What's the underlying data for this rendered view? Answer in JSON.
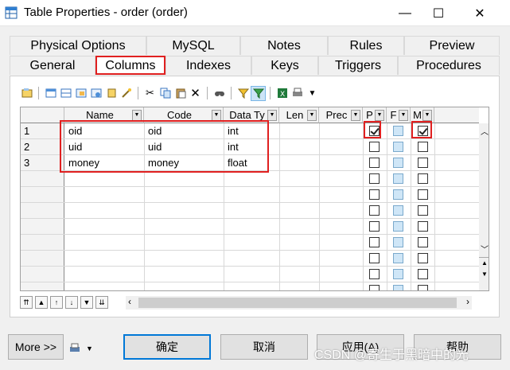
{
  "window": {
    "title": "Table Properties - order (order)"
  },
  "tabs_row1": [
    {
      "label": "Physical Options"
    },
    {
      "label": "MySQL"
    },
    {
      "label": "Notes"
    },
    {
      "label": "Rules"
    },
    {
      "label": "Preview"
    }
  ],
  "tabs_row2": [
    {
      "label": "General"
    },
    {
      "label": "Columns"
    },
    {
      "label": "Indexes"
    },
    {
      "label": "Keys"
    },
    {
      "label": "Triggers"
    },
    {
      "label": "Procedures"
    }
  ],
  "grid": {
    "headers": [
      "Name",
      "Code",
      "Data Ty",
      "Len",
      "Prec",
      "P",
      "F",
      "M"
    ],
    "rows": [
      {
        "num": "1",
        "name": "oid",
        "code": "oid",
        "type": "int",
        "p": true,
        "m": true
      },
      {
        "num": "2",
        "name": "uid",
        "code": "uid",
        "type": "int",
        "p": false,
        "m": false
      },
      {
        "num": "3",
        "name": "money",
        "code": "money",
        "type": "float",
        "p": false,
        "m": false
      }
    ]
  },
  "buttons": {
    "more": "More >>",
    "ok": "确定",
    "cancel": "取消",
    "apply": "应用(A)",
    "help": "帮助"
  },
  "watermark": "CSDN @寄生于黑暗中的光",
  "colors": {
    "highlight": "#e02020",
    "accent": "#0078d7"
  }
}
